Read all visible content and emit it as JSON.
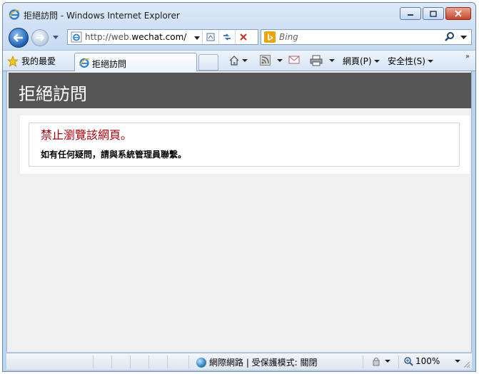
{
  "window": {
    "title": "拒絕訪問 - Windows Internet Explorer"
  },
  "nav": {
    "address": "http://web.wechat.com/",
    "address_prefix": "http://web.",
    "address_host": "wechat.com/",
    "search_placeholder": "Bing"
  },
  "commandbar": {
    "favorites_label": "我的最愛",
    "tab_label": "拒絕訪問",
    "page_menu": "網頁(P)",
    "safety_menu": "安全性(S)"
  },
  "page": {
    "header_title": "拒絕訪問",
    "error_title": "禁止瀏覽該網頁。",
    "error_message": "如有任何疑問，請與系統管理員聯繫。"
  },
  "statusbar": {
    "zone_text": "網際網路 | 受保護模式: 關閉",
    "zoom": "100%"
  },
  "colors": {
    "header_bg": "#555555",
    "error_title": "#b0000a"
  }
}
